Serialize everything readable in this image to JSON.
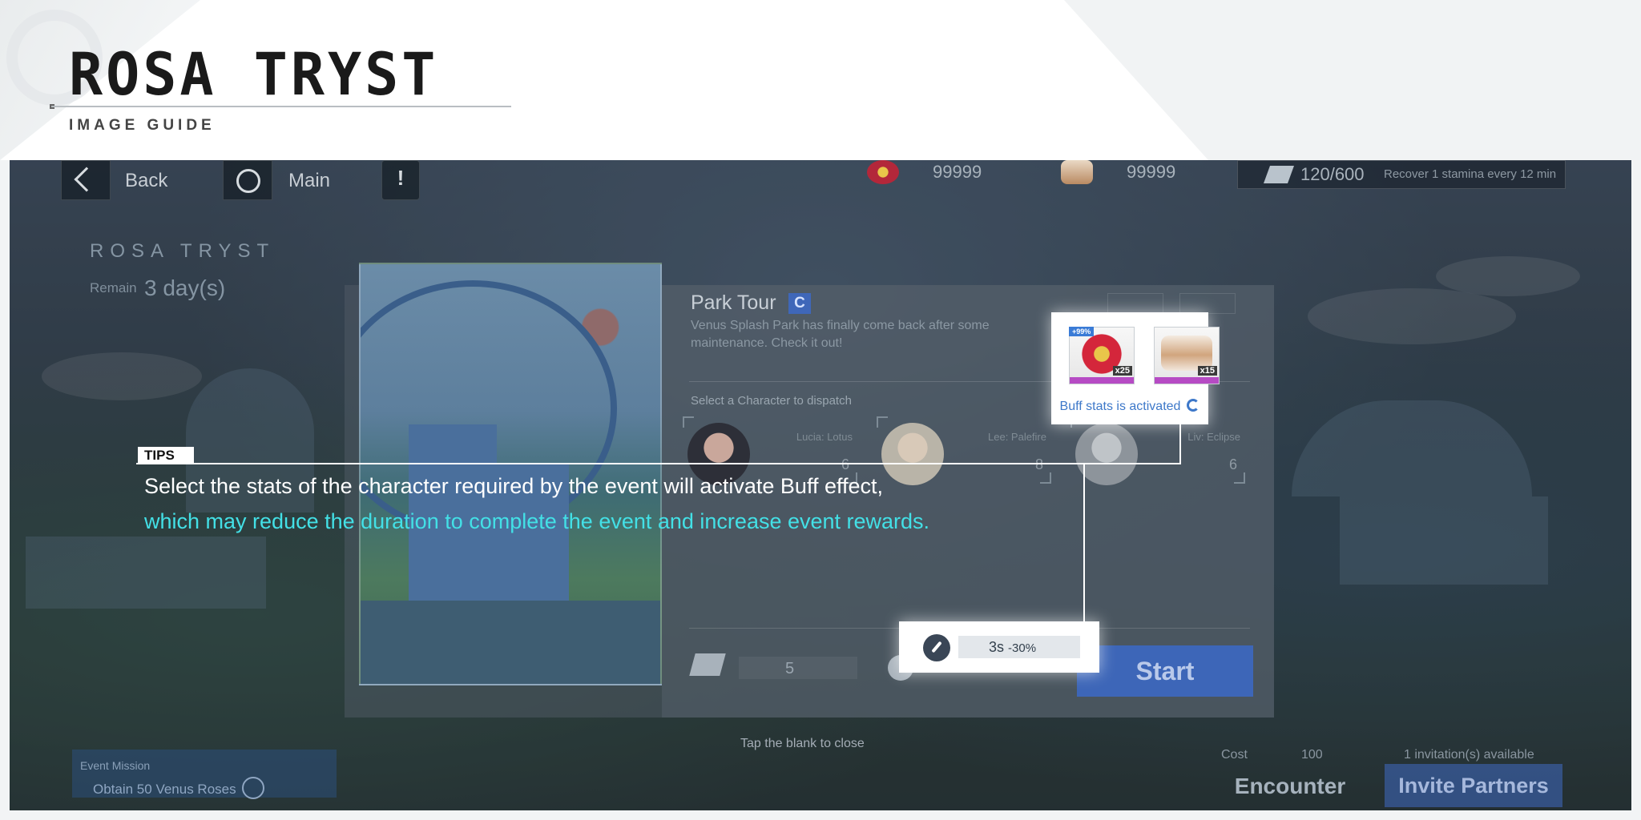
{
  "guide": {
    "title": "ROSA TRYST",
    "subtitle": "IMAGE GUIDE"
  },
  "topbar": {
    "back_label": "Back",
    "main_label": "Main",
    "resource1_value": "99999",
    "resource2_value": "99999",
    "stamina_value": "120/600",
    "stamina_text": "Recover 1 stamina every 12 min"
  },
  "event": {
    "name": "ROSA TRYST",
    "remain_label": "Remain",
    "remain_value": "3 day(s)"
  },
  "dialog": {
    "mission_name": "Park Tour",
    "mission_rank": "C",
    "mission_desc": "Venus Splash Park has finally come back after some maintenance. Check it out!",
    "select_label": "Select a Character to dispatch",
    "characters": [
      {
        "name": "Lucia: Lotus",
        "stat": "6"
      },
      {
        "name": "Lee: Palefire",
        "stat": "8"
      },
      {
        "name": "Liv: Eclipse",
        "stat": "6"
      }
    ],
    "cost_value": "5",
    "start_label": "Start"
  },
  "buff_highlight": {
    "item1_tag": "+99%",
    "item1_qty": "x25",
    "item2_qty": "x15",
    "text": "Buff stats is activated"
  },
  "time_highlight": {
    "value": "3s",
    "reduction": "-30%"
  },
  "footer": {
    "tap_close": "Tap the blank to close",
    "mission_label": "Event Mission",
    "mission_value": "Obtain 50 Venus Roses",
    "cost_label": "Cost",
    "cost_value": "100",
    "encounter_label": "Encounter",
    "invite_available": "1 invitation(s) available",
    "invite_label": "Invite Partners"
  },
  "tips": {
    "tag": "TIPS",
    "line1": "Select the stats of the character required by the event will activate Buff effect,",
    "line2": "which may reduce the duration to complete the event and increase event rewards."
  },
  "colors": {
    "highlight_text": "#43e0e6",
    "start_button": "#3d66b8",
    "buff_text": "#3d78c9"
  }
}
